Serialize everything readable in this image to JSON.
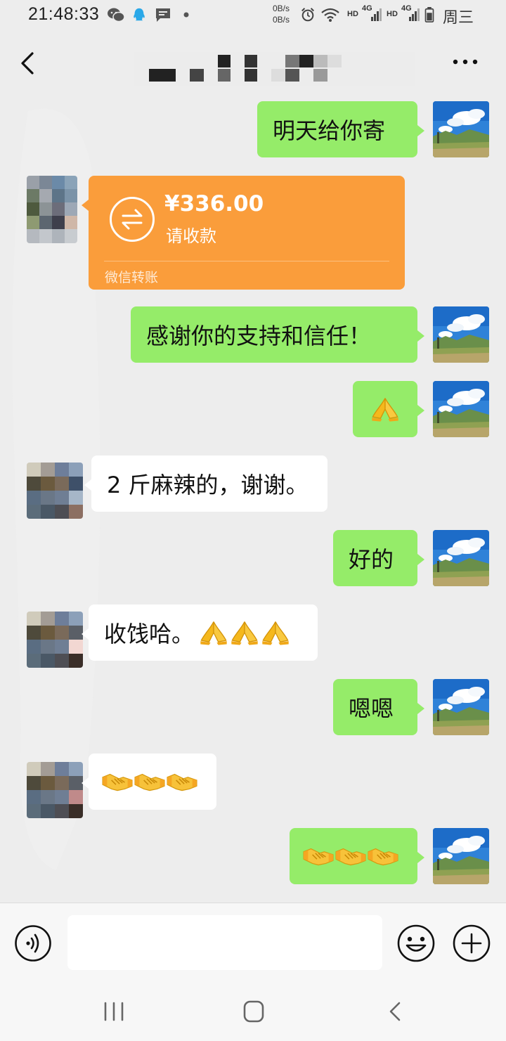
{
  "status_bar": {
    "time": "21:48:33",
    "net_up": "0B/s",
    "net_down": "0B/s",
    "signal_labels": [
      "HD",
      "4G",
      "HD",
      "4G"
    ],
    "weekday": "周三",
    "icons": [
      "wechat-icon",
      "qq-icon",
      "message-icon",
      "dot-icon",
      "alarm-icon",
      "wifi-icon",
      "signal-icon",
      "battery-icon"
    ]
  },
  "nav": {
    "back_icon": "chevron-left-icon",
    "title": "",
    "more_icon": "more-dots-icon"
  },
  "messages": [
    {
      "side": "right",
      "text": "明天给你寄"
    },
    {
      "side": "left",
      "type": "transfer",
      "amount": "¥336.00",
      "label": "请收款",
      "footer": "微信转账"
    },
    {
      "side": "right",
      "text": "感谢你的支持和信任！"
    },
    {
      "side": "right",
      "emoji": [
        "folded-hands"
      ]
    },
    {
      "side": "left",
      "text": "2 斤麻辣的，谢谢。"
    },
    {
      "side": "right",
      "text": "好的"
    },
    {
      "side": "left",
      "text": "收饯哈。",
      "emoji": [
        "folded-hands",
        "folded-hands",
        "folded-hands"
      ]
    },
    {
      "side": "right",
      "text": "嗯嗯"
    },
    {
      "side": "left",
      "emoji": [
        "handshake",
        "handshake",
        "handshake"
      ]
    },
    {
      "side": "right",
      "emoji": [
        "handshake",
        "handshake",
        "handshake"
      ]
    }
  ],
  "input_bar": {
    "voice_icon": "voice-icon",
    "input_value": "",
    "emoji_icon": "smiley-icon",
    "plus_icon": "plus-icon"
  },
  "system_nav": {
    "icons": [
      "recent-apps-icon",
      "home-icon",
      "back-icon"
    ]
  },
  "colors": {
    "background": "#ededed",
    "green_bubble": "#95ec69",
    "white_bubble": "#ffffff",
    "transfer": "#fa9d3b"
  }
}
